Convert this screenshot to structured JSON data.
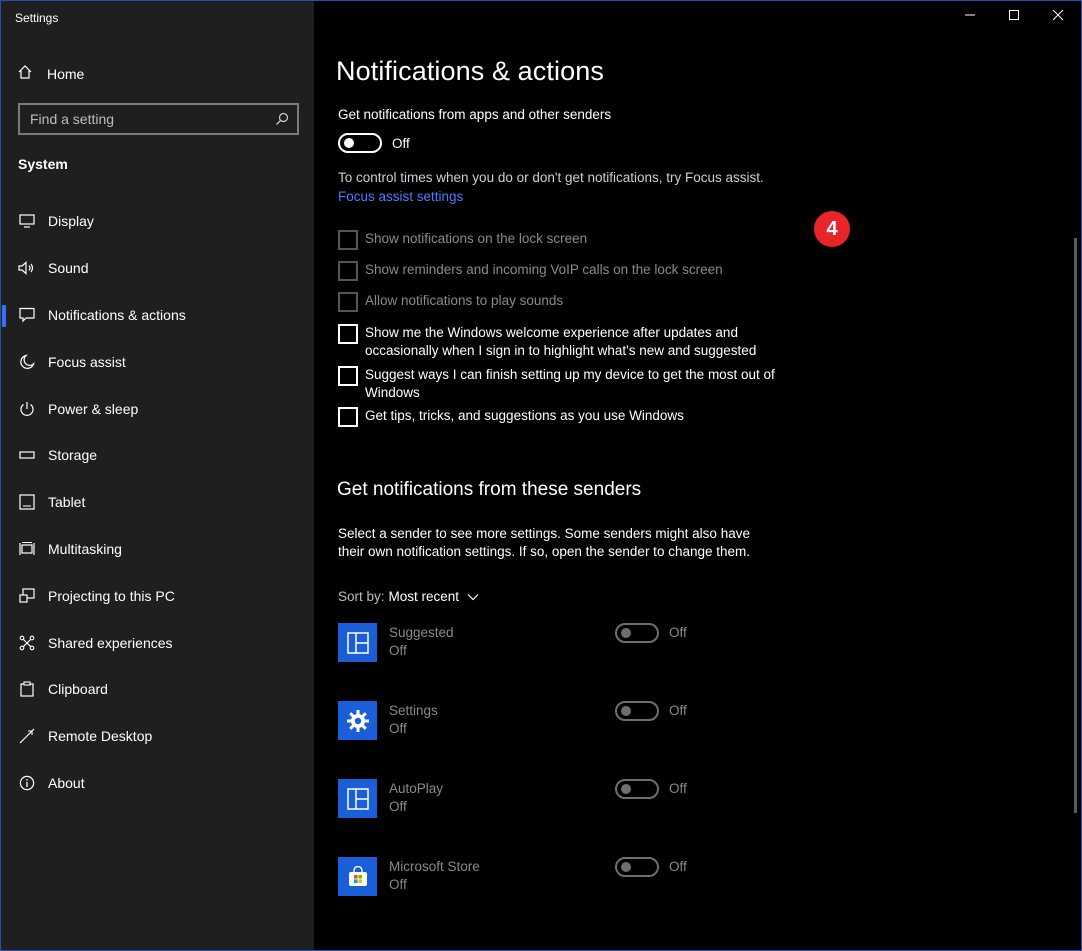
{
  "window": {
    "title": "Settings"
  },
  "sidebar": {
    "home_label": "Home",
    "search": {
      "placeholder": "Find a setting"
    },
    "section_label": "System",
    "items": [
      {
        "label": "Display",
        "icon": "monitor-icon"
      },
      {
        "label": "Sound",
        "icon": "speaker-icon"
      },
      {
        "label": "Notifications & actions",
        "icon": "message-icon",
        "active": true
      },
      {
        "label": "Focus assist",
        "icon": "moon-icon"
      },
      {
        "label": "Power & sleep",
        "icon": "power-icon"
      },
      {
        "label": "Storage",
        "icon": "storage-icon"
      },
      {
        "label": "Tablet",
        "icon": "tablet-icon"
      },
      {
        "label": "Multitasking",
        "icon": "multitasking-icon"
      },
      {
        "label": "Projecting to this PC",
        "icon": "projector-icon"
      },
      {
        "label": "Shared experiences",
        "icon": "share-icon"
      },
      {
        "label": "Clipboard",
        "icon": "clipboard-icon"
      },
      {
        "label": "Remote Desktop",
        "icon": "remote-icon"
      },
      {
        "label": "About",
        "icon": "info-icon"
      }
    ]
  },
  "main": {
    "title": "Notifications & actions",
    "get_notifications_label": "Get notifications from apps and other senders",
    "main_toggle_state": "Off",
    "focus_hint": "To control times when you do or don't get notifications, try Focus assist.",
    "focus_link": "Focus assist settings",
    "checkboxes": [
      {
        "label": "Show notifications on the lock screen",
        "disabled": true
      },
      {
        "label": "Show reminders and incoming VoIP calls on the lock screen",
        "disabled": true
      },
      {
        "label": "Allow notifications to play sounds",
        "disabled": true
      },
      {
        "label": "Show me the Windows welcome experience after updates and occasionally when I sign in to highlight what's new and suggested",
        "disabled": false
      },
      {
        "label": "Suggest ways I can finish setting up my device to get the most out of Windows",
        "disabled": false
      },
      {
        "label": "Get tips, tricks, and suggestions as you use Windows",
        "disabled": false
      }
    ],
    "senders_title": "Get notifications from these senders",
    "senders_desc": "Select a sender to see more settings. Some senders might also have their own notification settings. If so, open the sender to change them.",
    "sort_label": "Sort by:",
    "sort_value": "Most recent",
    "senders": [
      {
        "name": "Suggested",
        "state": "Off",
        "toggle": "Off",
        "icon": "suggested-app-icon"
      },
      {
        "name": "Settings",
        "state": "Off",
        "toggle": "Off",
        "icon": "settings-gear-icon"
      },
      {
        "name": "AutoPlay",
        "state": "Off",
        "toggle": "Off",
        "icon": "autoplay-app-icon"
      },
      {
        "name": "Microsoft Store",
        "state": "Off",
        "toggle": "Off",
        "icon": "store-bag-icon"
      }
    ]
  },
  "annotation_badge": "4",
  "colors": {
    "accent": "#3a6df0",
    "link": "#4b7bff",
    "tile": "#1a5fd8",
    "badge": "#e8262a"
  }
}
